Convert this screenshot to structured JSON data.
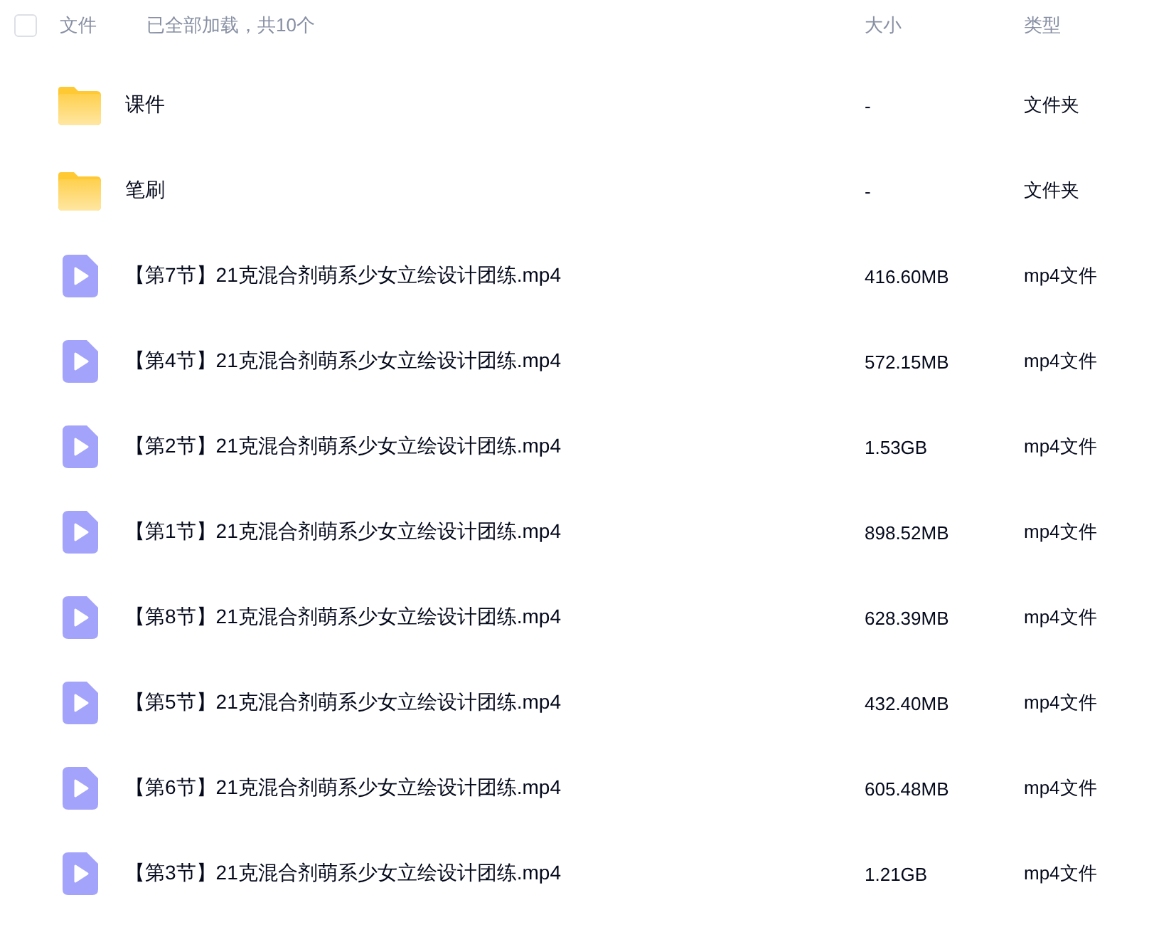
{
  "header": {
    "select_all_checked": false,
    "name_label": "文件",
    "status": "已全部加载，共10个",
    "size_label": "大小",
    "type_label": "类型"
  },
  "files": [
    {
      "kind": "folder",
      "name": "课件",
      "size": "-",
      "type": "文件夹"
    },
    {
      "kind": "folder",
      "name": "笔刷",
      "size": "-",
      "type": "文件夹"
    },
    {
      "kind": "video",
      "name": "【第7节】21克混合剂萌系少女立绘设计团练.mp4",
      "size": "416.60MB",
      "type": "mp4文件"
    },
    {
      "kind": "video",
      "name": "【第4节】21克混合剂萌系少女立绘设计团练.mp4",
      "size": "572.15MB",
      "type": "mp4文件"
    },
    {
      "kind": "video",
      "name": "【第2节】21克混合剂萌系少女立绘设计团练.mp4",
      "size": "1.53GB",
      "type": "mp4文件"
    },
    {
      "kind": "video",
      "name": "【第1节】21克混合剂萌系少女立绘设计团练.mp4",
      "size": "898.52MB",
      "type": "mp4文件"
    },
    {
      "kind": "video",
      "name": "【第8节】21克混合剂萌系少女立绘设计团练.mp4",
      "size": "628.39MB",
      "type": "mp4文件"
    },
    {
      "kind": "video",
      "name": "【第5节】21克混合剂萌系少女立绘设计团练.mp4",
      "size": "432.40MB",
      "type": "mp4文件"
    },
    {
      "kind": "video",
      "name": "【第6节】21克混合剂萌系少女立绘设计团练.mp4",
      "size": "605.48MB",
      "type": "mp4文件"
    },
    {
      "kind": "video",
      "name": "【第3节】21克混合剂萌系少女立绘设计团练.mp4",
      "size": "1.21GB",
      "type": "mp4文件"
    }
  ]
}
